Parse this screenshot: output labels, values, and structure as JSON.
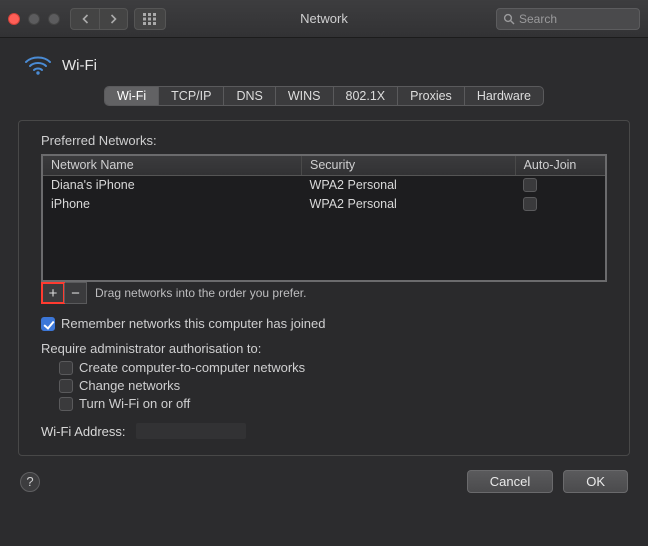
{
  "window": {
    "title": "Network"
  },
  "search": {
    "placeholder": "Search"
  },
  "header": {
    "service": "Wi-Fi"
  },
  "tabs": [
    "Wi-Fi",
    "TCP/IP",
    "DNS",
    "WINS",
    "802.1X",
    "Proxies",
    "Hardware"
  ],
  "active_tab": "Wi-Fi",
  "preferred": {
    "label": "Preferred Networks:",
    "columns": {
      "name": "Network Name",
      "security": "Security",
      "autojoin": "Auto-Join"
    },
    "rows": [
      {
        "name": "Diana's iPhone",
        "security": "WPA2 Personal",
        "autojoin": false
      },
      {
        "name": "iPhone",
        "security": "WPA2 Personal",
        "autojoin": false
      }
    ],
    "hint": "Drag networks into the order you prefer."
  },
  "options": {
    "remember": {
      "label": "Remember networks this computer has joined",
      "checked": true
    },
    "admin_label": "Require administrator authorisation to:",
    "admin_opts": {
      "create_adhoc": {
        "label": "Create computer-to-computer networks",
        "checked": false
      },
      "change_networks": {
        "label": "Change networks",
        "checked": false
      },
      "toggle_wifi": {
        "label": "Turn Wi-Fi on or off",
        "checked": false
      }
    }
  },
  "wifi_address": {
    "label": "Wi-Fi Address:",
    "value": ""
  },
  "buttons": {
    "cancel": "Cancel",
    "ok": "OK"
  },
  "icons": {
    "plus": "+",
    "minus": "−",
    "help": "?"
  }
}
